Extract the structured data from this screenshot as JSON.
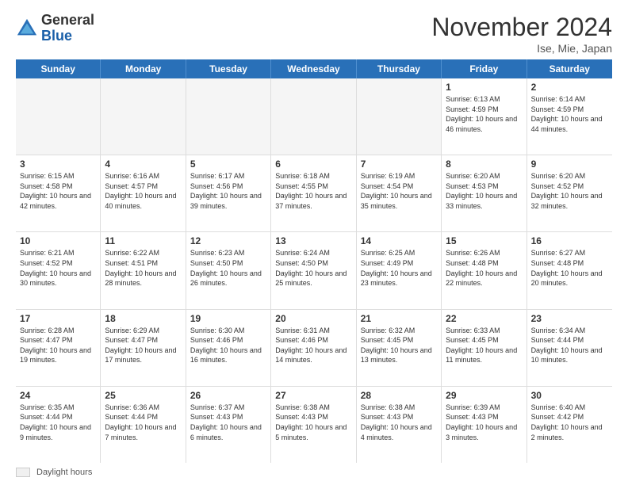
{
  "header": {
    "logo_general": "General",
    "logo_blue": "Blue",
    "month_title": "November 2024",
    "location": "Ise, Mie, Japan"
  },
  "weekdays": [
    "Sunday",
    "Monday",
    "Tuesday",
    "Wednesday",
    "Thursday",
    "Friday",
    "Saturday"
  ],
  "footer": {
    "daylight_label": "Daylight hours"
  },
  "rows": [
    [
      {
        "day": "",
        "info": "",
        "empty": true
      },
      {
        "day": "",
        "info": "",
        "empty": true
      },
      {
        "day": "",
        "info": "",
        "empty": true
      },
      {
        "day": "",
        "info": "",
        "empty": true
      },
      {
        "day": "",
        "info": "",
        "empty": true
      },
      {
        "day": "1",
        "info": "Sunrise: 6:13 AM\nSunset: 4:59 PM\nDaylight: 10 hours and 46 minutes.",
        "empty": false
      },
      {
        "day": "2",
        "info": "Sunrise: 6:14 AM\nSunset: 4:59 PM\nDaylight: 10 hours and 44 minutes.",
        "empty": false
      }
    ],
    [
      {
        "day": "3",
        "info": "Sunrise: 6:15 AM\nSunset: 4:58 PM\nDaylight: 10 hours and 42 minutes.",
        "empty": false
      },
      {
        "day": "4",
        "info": "Sunrise: 6:16 AM\nSunset: 4:57 PM\nDaylight: 10 hours and 40 minutes.",
        "empty": false
      },
      {
        "day": "5",
        "info": "Sunrise: 6:17 AM\nSunset: 4:56 PM\nDaylight: 10 hours and 39 minutes.",
        "empty": false
      },
      {
        "day": "6",
        "info": "Sunrise: 6:18 AM\nSunset: 4:55 PM\nDaylight: 10 hours and 37 minutes.",
        "empty": false
      },
      {
        "day": "7",
        "info": "Sunrise: 6:19 AM\nSunset: 4:54 PM\nDaylight: 10 hours and 35 minutes.",
        "empty": false
      },
      {
        "day": "8",
        "info": "Sunrise: 6:20 AM\nSunset: 4:53 PM\nDaylight: 10 hours and 33 minutes.",
        "empty": false
      },
      {
        "day": "9",
        "info": "Sunrise: 6:20 AM\nSunset: 4:52 PM\nDaylight: 10 hours and 32 minutes.",
        "empty": false
      }
    ],
    [
      {
        "day": "10",
        "info": "Sunrise: 6:21 AM\nSunset: 4:52 PM\nDaylight: 10 hours and 30 minutes.",
        "empty": false
      },
      {
        "day": "11",
        "info": "Sunrise: 6:22 AM\nSunset: 4:51 PM\nDaylight: 10 hours and 28 minutes.",
        "empty": false
      },
      {
        "day": "12",
        "info": "Sunrise: 6:23 AM\nSunset: 4:50 PM\nDaylight: 10 hours and 26 minutes.",
        "empty": false
      },
      {
        "day": "13",
        "info": "Sunrise: 6:24 AM\nSunset: 4:50 PM\nDaylight: 10 hours and 25 minutes.",
        "empty": false
      },
      {
        "day": "14",
        "info": "Sunrise: 6:25 AM\nSunset: 4:49 PM\nDaylight: 10 hours and 23 minutes.",
        "empty": false
      },
      {
        "day": "15",
        "info": "Sunrise: 6:26 AM\nSunset: 4:48 PM\nDaylight: 10 hours and 22 minutes.",
        "empty": false
      },
      {
        "day": "16",
        "info": "Sunrise: 6:27 AM\nSunset: 4:48 PM\nDaylight: 10 hours and 20 minutes.",
        "empty": false
      }
    ],
    [
      {
        "day": "17",
        "info": "Sunrise: 6:28 AM\nSunset: 4:47 PM\nDaylight: 10 hours and 19 minutes.",
        "empty": false
      },
      {
        "day": "18",
        "info": "Sunrise: 6:29 AM\nSunset: 4:47 PM\nDaylight: 10 hours and 17 minutes.",
        "empty": false
      },
      {
        "day": "19",
        "info": "Sunrise: 6:30 AM\nSunset: 4:46 PM\nDaylight: 10 hours and 16 minutes.",
        "empty": false
      },
      {
        "day": "20",
        "info": "Sunrise: 6:31 AM\nSunset: 4:46 PM\nDaylight: 10 hours and 14 minutes.",
        "empty": false
      },
      {
        "day": "21",
        "info": "Sunrise: 6:32 AM\nSunset: 4:45 PM\nDaylight: 10 hours and 13 minutes.",
        "empty": false
      },
      {
        "day": "22",
        "info": "Sunrise: 6:33 AM\nSunset: 4:45 PM\nDaylight: 10 hours and 11 minutes.",
        "empty": false
      },
      {
        "day": "23",
        "info": "Sunrise: 6:34 AM\nSunset: 4:44 PM\nDaylight: 10 hours and 10 minutes.",
        "empty": false
      }
    ],
    [
      {
        "day": "24",
        "info": "Sunrise: 6:35 AM\nSunset: 4:44 PM\nDaylight: 10 hours and 9 minutes.",
        "empty": false
      },
      {
        "day": "25",
        "info": "Sunrise: 6:36 AM\nSunset: 4:44 PM\nDaylight: 10 hours and 7 minutes.",
        "empty": false
      },
      {
        "day": "26",
        "info": "Sunrise: 6:37 AM\nSunset: 4:43 PM\nDaylight: 10 hours and 6 minutes.",
        "empty": false
      },
      {
        "day": "27",
        "info": "Sunrise: 6:38 AM\nSunset: 4:43 PM\nDaylight: 10 hours and 5 minutes.",
        "empty": false
      },
      {
        "day": "28",
        "info": "Sunrise: 6:38 AM\nSunset: 4:43 PM\nDaylight: 10 hours and 4 minutes.",
        "empty": false
      },
      {
        "day": "29",
        "info": "Sunrise: 6:39 AM\nSunset: 4:43 PM\nDaylight: 10 hours and 3 minutes.",
        "empty": false
      },
      {
        "day": "30",
        "info": "Sunrise: 6:40 AM\nSunset: 4:42 PM\nDaylight: 10 hours and 2 minutes.",
        "empty": false
      }
    ]
  ]
}
